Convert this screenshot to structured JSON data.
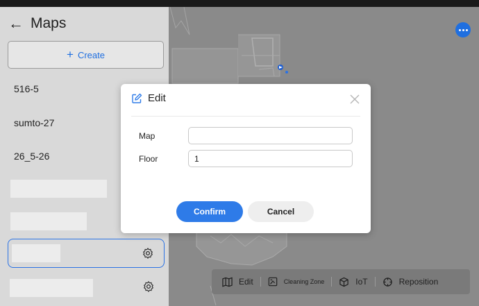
{
  "sidebar": {
    "title": "Maps",
    "create_label": "Create",
    "maps": [
      {
        "label": "516-5"
      },
      {
        "label": "sumto-27"
      },
      {
        "label": "26_5-26"
      }
    ]
  },
  "dialog": {
    "title": "Edit",
    "fields": {
      "map_label": "Map",
      "map_value": "",
      "floor_label": "Floor",
      "floor_value": "1"
    },
    "confirm_label": "Confirm",
    "cancel_label": "Cancel"
  },
  "toolbar": {
    "items": [
      {
        "label": "Edit",
        "icon": "map-icon"
      },
      {
        "label": "Cleaning Zone",
        "icon": "zone-icon"
      },
      {
        "label": "IoT",
        "icon": "cube-icon"
      },
      {
        "label": "Reposition",
        "icon": "target-icon"
      }
    ]
  },
  "colors": {
    "accent": "#2e7be8",
    "sidebar_bg": "#d9d9d9",
    "map_bg": "#8a8a8a"
  }
}
